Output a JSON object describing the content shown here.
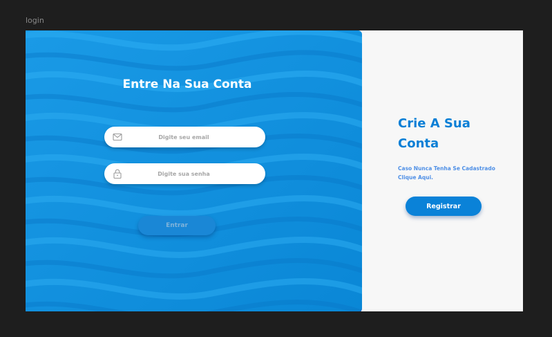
{
  "frame": {
    "label": "login"
  },
  "login": {
    "title": "Entre Na Sua Conta",
    "email_placeholder": "Digite seu email",
    "password_placeholder": "Digite sua senha",
    "submit_label": "Entrar",
    "email_icon": "mail-icon",
    "password_icon": "lock-icon"
  },
  "signup": {
    "title": "Crie A Sua Conta",
    "text": "Caso Nunca Tenha Se Cadastrado Clique Aqui.",
    "button_label": "Registrar"
  },
  "colors": {
    "canvas_background": "#1e1e1e",
    "left_panel_blue": "#0a8fdc",
    "right_panel_background": "#f7f7f7",
    "accent_blue": "#0a7fd6",
    "signup_text_blue": "#4e8fe6",
    "placeholder_gray": "#a6a6a6"
  }
}
